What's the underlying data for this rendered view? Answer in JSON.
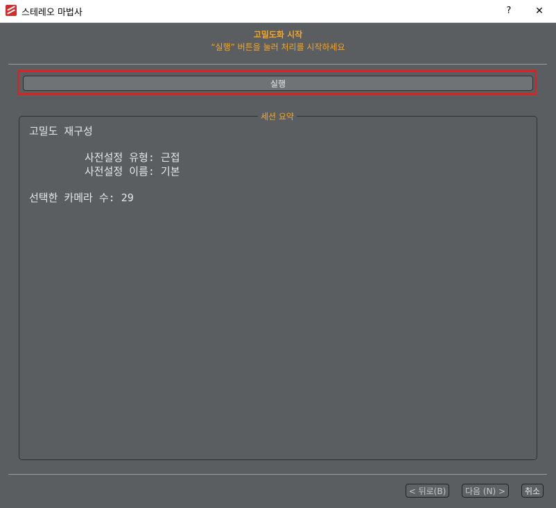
{
  "window": {
    "title": "스테레오 마법사",
    "help_label": "?",
    "close_label": "✕"
  },
  "header": {
    "title": "고밀도화 시작",
    "subtitle": "“실행” 버튼을 눌러 처리를 시작하세요"
  },
  "run_button": {
    "label": "실행"
  },
  "summary": {
    "legend": "세션 요약",
    "heading": "고밀도 재구성",
    "preset_type": "사전설정 유형: 근접",
    "preset_name": "사전설정 이름: 기본",
    "camera_count": "선택한 카메라 수: 29"
  },
  "footer": {
    "back_label": "< 뒤로(B)",
    "next_label": "다음 (N) >",
    "cancel_label": "취소"
  },
  "colors": {
    "accent": "#f5a623",
    "highlight": "#e02020",
    "background": "#5b5e61"
  }
}
